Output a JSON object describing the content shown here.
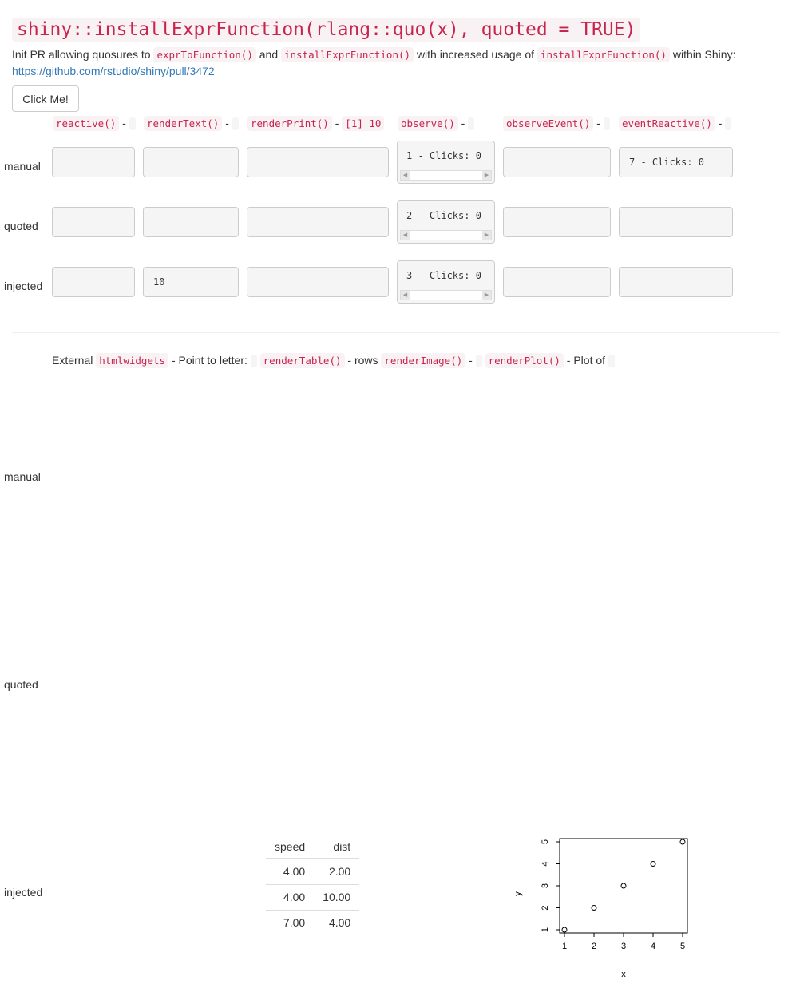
{
  "title": "shiny::installExprFunction(rlang::quo(x), quoted = TRUE)",
  "intro": {
    "prefix": "Init PR allowing quosures to",
    "code1": "exprToFunction()",
    "and": "and",
    "code2": "installExprFunction()",
    "middle": "with increased usage of",
    "code3": "installExprFunction()",
    "suffix": "within Shiny:",
    "link": "https://github.com/rstudio/shiny/pull/3472"
  },
  "button": {
    "label": "Click Me!"
  },
  "header1": {
    "reactive": "reactive()",
    "renderText": "renderText()",
    "renderPrint": "renderPrint()",
    "renderPrintValue": "[1] 10",
    "observe": "observe()",
    "observeEvent": "observeEvent()",
    "eventReactive": "eventReactive()",
    "dash": "-"
  },
  "rows": {
    "manual": "manual",
    "quoted": "quoted",
    "injected": "injected"
  },
  "cells": {
    "manual": {
      "reactive": "",
      "renderText": "",
      "renderPrint": "",
      "observe": "1 - Clicks: 0",
      "observeEvent": "",
      "eventReactive": "7 - Clicks: 0"
    },
    "quoted": {
      "reactive": "",
      "renderText": "",
      "renderPrint": "",
      "observe": "2 - Clicks: 0",
      "observeEvent": "",
      "eventReactive": ""
    },
    "injected": {
      "reactive": "",
      "renderText": "10",
      "renderPrint": "",
      "observe": "3 - Clicks: 0",
      "observeEvent": "",
      "eventReactive": ""
    }
  },
  "header2": {
    "external": "External",
    "htmlwidgets": "htmlwidgets",
    "pointText": "- Point to letter:",
    "renderTable": "renderTable()",
    "rows": "rows",
    "renderImage": "renderImage()",
    "renderPlot": "renderPlot()",
    "plotOf": "- Plot of",
    "dash": "-"
  },
  "table": {
    "headers": [
      "speed",
      "dist"
    ],
    "rows": [
      [
        "4.00",
        "2.00"
      ],
      [
        "4.00",
        "10.00"
      ],
      [
        "7.00",
        "4.00"
      ]
    ]
  },
  "chart_data": {
    "type": "scatter",
    "x": [
      1,
      2,
      3,
      4,
      5
    ],
    "y": [
      1,
      2,
      3,
      4,
      5
    ],
    "xlabel": "x",
    "ylabel": "y",
    "xlim": [
      1,
      5
    ],
    "ylim": [
      1,
      5
    ],
    "xticks": [
      "1",
      "2",
      "3",
      "4",
      "5"
    ],
    "yticks": [
      "1",
      "2",
      "3",
      "4",
      "5"
    ]
  }
}
